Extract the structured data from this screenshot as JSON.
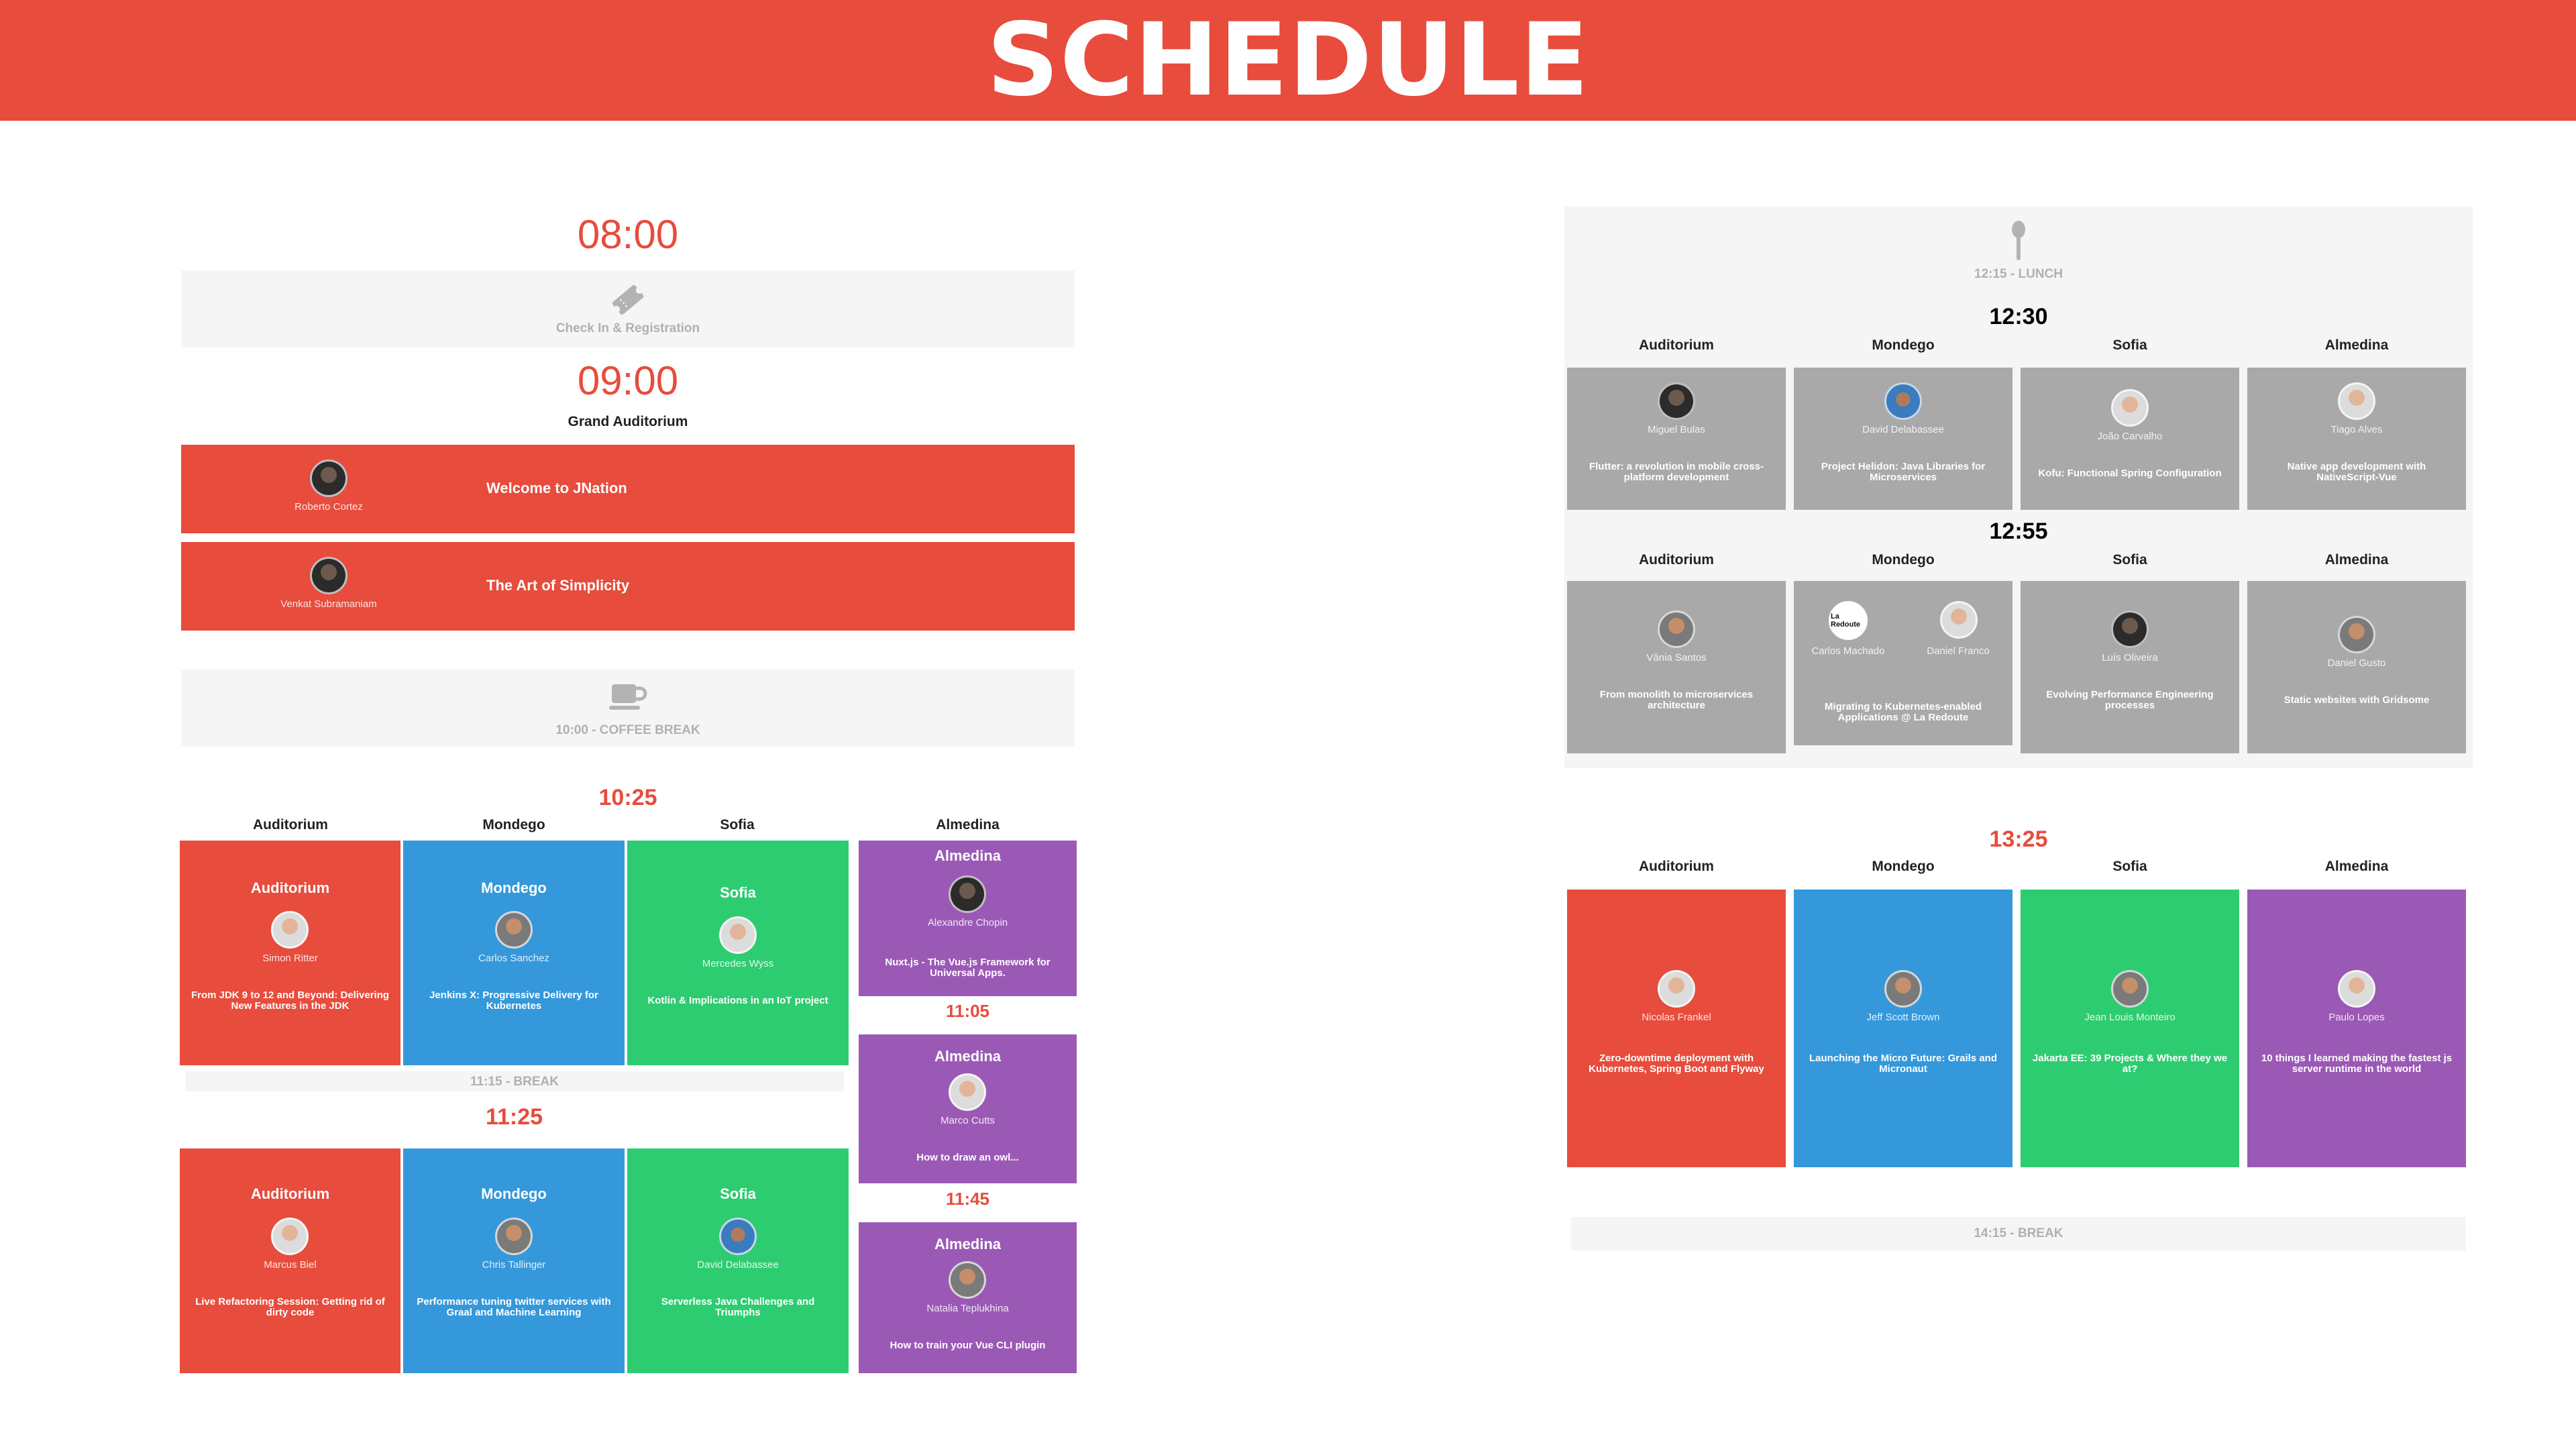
{
  "header": {
    "title": "SCHEDULE"
  },
  "left": {
    "t0800": "08:00",
    "checkin": "Check In & Registration",
    "t0900": "09:00",
    "grand": "Grand Auditorium",
    "keynote1": {
      "speaker": "Roberto Cortez",
      "talk": "Welcome to JNation"
    },
    "keynote2": {
      "speaker": "Venkat Subramaniam",
      "talk": "The Art of Simplicity"
    },
    "coffee": "10:00 - COFFEE BREAK",
    "t1025": "10:25",
    "rooms": [
      "Auditorium",
      "Mondego",
      "Sofia",
      "Almedina"
    ],
    "s1025": [
      {
        "room": "Auditorium",
        "speaker": "Simon Ritter",
        "talk": "From JDK 9 to 12 and Beyond: Delivering New Features in the JDK"
      },
      {
        "room": "Mondego",
        "speaker": "Carlos Sanchez",
        "talk": "Jenkins X: Progressive Delivery for Kubernetes"
      },
      {
        "room": "Sofia",
        "speaker": "Mercedes Wyss",
        "talk": "Kotlin & Implications in an IoT project"
      },
      {
        "room": "Almedina",
        "speaker": "Alexandre Chopin",
        "talk": "Nuxt.js - The Vue.js Framework for Universal Apps."
      }
    ],
    "break1115": "11:15 - BREAK",
    "t1125": "11:25",
    "s1125": [
      {
        "room": "Auditorium",
        "speaker": "Marcus Biel",
        "talk": "Live Refactoring Session: Getting rid of dirty code"
      },
      {
        "room": "Mondego",
        "speaker": "Chris Tallinger",
        "talk": "Performance tuning twitter services with Graal and Machine Learning"
      },
      {
        "room": "Sofia",
        "speaker": "David Delabassee",
        "talk": "Serverless Java Challenges and Triumphs"
      }
    ],
    "t1105": "11:05",
    "s1105": {
      "room": "Almedina",
      "speaker": "Marco Cutts",
      "talk": "How to draw an owl..."
    },
    "t1145": "11:45",
    "s1145": {
      "room": "Almedina",
      "speaker": "Natalia Teplukhina",
      "talk": "How to train your Vue CLI plugin"
    }
  },
  "right": {
    "lunch": "12:15 - LUNCH",
    "t1230": "12:30",
    "rooms": [
      "Auditorium",
      "Mondego",
      "Sofia",
      "Almedina"
    ],
    "s1230": [
      {
        "speaker": "Miguel Bulas",
        "talk": "Flutter: a revolution in mobile cross-platform development"
      },
      {
        "speaker": "David Delabassee",
        "talk": "Project Helidon: Java Libraries for Microservices"
      },
      {
        "speaker": "João Carvalho",
        "talk": "Kofu: Functional Spring Configuration"
      },
      {
        "speaker": "Tiago Alves",
        "talk": "Native app development with NativeScript-Vue"
      }
    ],
    "t1255": "12:55",
    "s1255": [
      {
        "speaker": "Vânia Santos",
        "talk": "From monolith to microservices architecture"
      },
      {
        "speaker": "Carlos Machado",
        "speaker2": "Daniel Franco",
        "logo": "La Redoute",
        "talk": "Migrating to Kubernetes-enabled Applications @ La Redoute"
      },
      {
        "speaker": "Luís Oliveira",
        "talk": "Evolving Performance Engineering processes"
      },
      {
        "speaker": "Daniel Gusto",
        "talk": "Static websites with Gridsome"
      }
    ],
    "t1325": "13:25",
    "s1325": [
      {
        "speaker": "Nicolas Frankel",
        "talk": "Zero-downtime deployment with Kubernetes, Spring Boot and Flyway"
      },
      {
        "speaker": "Jeff Scott Brown",
        "talk": "Launching the Micro Future: Grails and Micronaut"
      },
      {
        "speaker": "Jean Louis Monteiro",
        "talk": "Jakarta EE: 39 Projects & Where they we at?"
      },
      {
        "speaker": "Paulo Lopes",
        "talk": "10 things I learned making the fastest js server runtime in the world"
      }
    ],
    "break1415": "14:15 - BREAK"
  },
  "icons": {
    "checkin": "ticket-icon",
    "coffee": "coffee-cup-icon",
    "lunch": "spoon-icon"
  },
  "colors": {
    "red": "#e74c3c",
    "blue": "#3498db",
    "green": "#2ecc71",
    "purple": "#9b59b6",
    "grey": "#a9a9a9"
  }
}
